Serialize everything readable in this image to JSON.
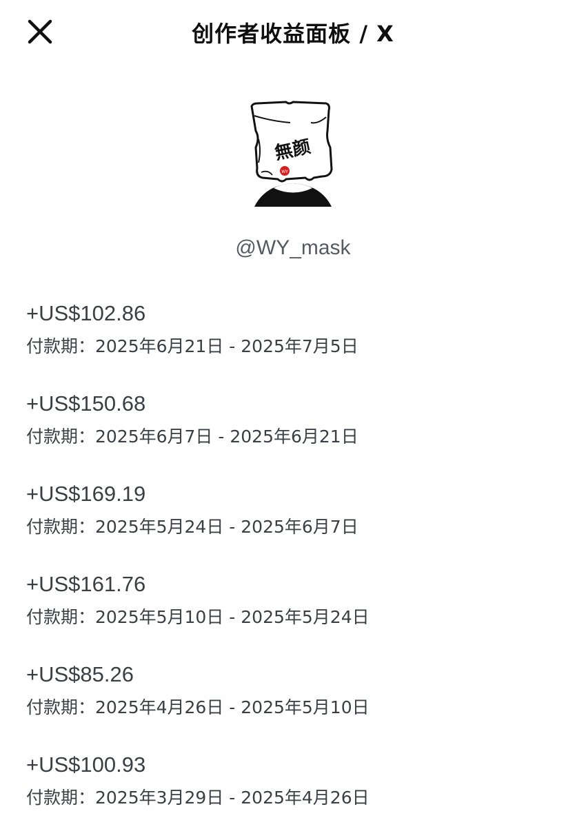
{
  "header": {
    "title": "创作者收益面板 / X",
    "close_icon": "close-icon"
  },
  "profile": {
    "avatar_text": "無颜",
    "avatar_stamp": "WY",
    "handle": "@WY_mask"
  },
  "payouts": [
    {
      "amount": "+US$102.86",
      "period": "付款期：2025年6月21日 - 2025年7月5日"
    },
    {
      "amount": "+US$150.68",
      "period": "付款期：2025年6月7日 - 2025年6月21日"
    },
    {
      "amount": "+US$169.19",
      "period": "付款期：2025年5月24日 - 2025年6月7日"
    },
    {
      "amount": "+US$161.76",
      "period": "付款期：2025年5月10日 - 2025年5月24日"
    },
    {
      "amount": "+US$85.26",
      "period": "付款期：2025年4月26日 - 2025年5月10日"
    },
    {
      "amount": "+US$100.93",
      "period": "付款期：2025年3月29日 - 2025年4月26日"
    }
  ],
  "colors": {
    "text_primary": "#111111",
    "text_secondary": "#3a3f44",
    "handle": "#555b61",
    "stamp_red": "#d62020"
  }
}
